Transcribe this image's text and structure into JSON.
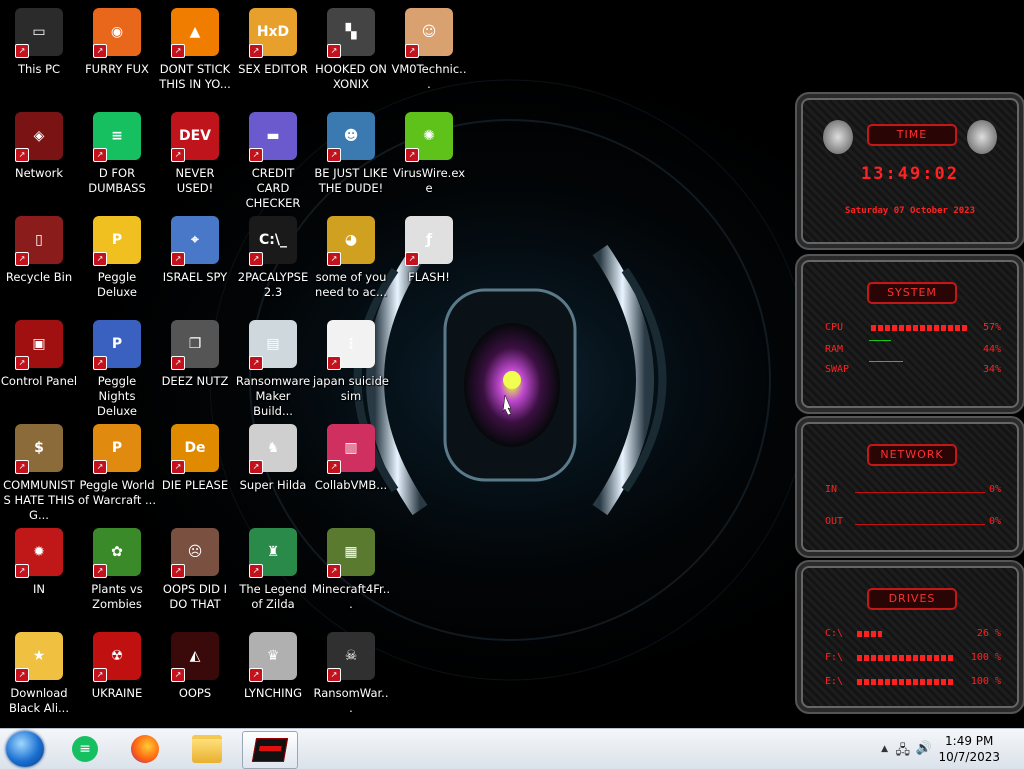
{
  "desktop_icons": [
    {
      "label": "This PC",
      "color": "#2b2b2b",
      "glyph": "▭"
    },
    {
      "label": "FURRY FUX",
      "color": "#e8671a",
      "glyph": "◉"
    },
    {
      "label": "DONT STICK THIS IN YO...",
      "color": "#f07c00",
      "glyph": "▲"
    },
    {
      "label": "SEX EDITOR",
      "color": "#e6a02b",
      "glyph": "HxD"
    },
    {
      "label": "HOOKED ON XONIX",
      "color": "#444444",
      "glyph": "▚"
    },
    {
      "label": "VM0Technic...",
      "color": "#d9a070",
      "glyph": "☺"
    },
    {
      "label": "Network",
      "color": "#7a1414",
      "glyph": "◈"
    },
    {
      "label": "D FOR DUMBASS",
      "color": "#16c060",
      "glyph": "≡"
    },
    {
      "label": "NEVER USED!",
      "color": "#c0141c",
      "glyph": "DEV"
    },
    {
      "label": "CREDIT CARD CHECKER",
      "color": "#6a5acd",
      "glyph": "▬"
    },
    {
      "label": "BE JUST LIKE THE DUDE!",
      "color": "#3a7ab0",
      "glyph": "☻"
    },
    {
      "label": "VirusWire.exe",
      "color": "#5fc21a",
      "glyph": "✺"
    },
    {
      "label": "Recycle Bin",
      "color": "#8a1c1c",
      "glyph": "▯"
    },
    {
      "label": "Peggle Deluxe",
      "color": "#f0c020",
      "glyph": "P"
    },
    {
      "label": "ISRAEL SPY",
      "color": "#4a78c8",
      "glyph": "⌖"
    },
    {
      "label": "2PACALYPSE 2.3",
      "color": "#1a1a1a",
      "glyph": "C:\\_"
    },
    {
      "label": "some of you need to ac...",
      "color": "#d0a020",
      "glyph": "◕"
    },
    {
      "label": "FLASH!",
      "color": "#e0e0e0",
      "glyph": "ƒ"
    },
    {
      "label": "Control Panel",
      "color": "#a01010",
      "glyph": "▣"
    },
    {
      "label": "Peggle Nights Deluxe",
      "color": "#3a60c0",
      "glyph": "P"
    },
    {
      "label": "DEEZ NUTZ",
      "color": "#555555",
      "glyph": "❐"
    },
    {
      "label": "Ransomware Maker Build...",
      "color": "#cfd8dc",
      "glyph": "▤"
    },
    {
      "label": "japan suicide sim",
      "color": "#f2f2f2",
      "glyph": "⋮"
    },
    {
      "label": "COMMUNISTS HATE THIS G...",
      "color": "#8b6b3a",
      "glyph": "$"
    },
    {
      "label": "Peggle World of Warcraft ...",
      "color": "#e08a10",
      "glyph": "P"
    },
    {
      "label": "DIE PLEASE",
      "color": "#e08a00",
      "glyph": "De"
    },
    {
      "label": "Super Hilda",
      "color": "#cfcfcf",
      "glyph": "♞"
    },
    {
      "label": "CollabVMB...",
      "color": "#d03060",
      "glyph": "▥"
    },
    {
      "label": "IN",
      "color": "#c01818",
      "glyph": "✹"
    },
    {
      "label": "Plants vs Zombies",
      "color": "#3a8a2a",
      "glyph": "✿"
    },
    {
      "label": "OOPS DID I DO THAT",
      "color": "#7a5040",
      "glyph": "☹"
    },
    {
      "label": "The Legend of Zilda",
      "color": "#2a8a4a",
      "glyph": "♜"
    },
    {
      "label": "Minecraft4Fr...",
      "color": "#5a7a30",
      "glyph": "▦"
    },
    {
      "label": "Download Black Ali...",
      "color": "#f0c040",
      "glyph": "★"
    },
    {
      "label": "UKRAINE",
      "color": "#c01010",
      "glyph": "☢"
    },
    {
      "label": "OOPS",
      "color": "#3a0a0a",
      "glyph": "◭"
    },
    {
      "label": "LYNCHING",
      "color": "#b0b0b0",
      "glyph": "♛"
    },
    {
      "label": "RansomWar...",
      "color": "#303030",
      "glyph": "☠"
    }
  ],
  "gadget": {
    "time_title": "TIME",
    "time_value": "13:49:02",
    "date_value": "Saturday 07 October 2023",
    "system_title": "SYSTEM",
    "cpu_label": "CPU",
    "cpu_value": "57%",
    "cpu_fraction": 0.57,
    "ram_label": "RAM",
    "ram_value": "44%",
    "swap_label": "SWAP",
    "swap_value": "34%",
    "network_title": "NETWORK",
    "in_label": "IN",
    "in_value": "0%",
    "out_label": "OUT",
    "out_value": "0%",
    "drives_title": "DRIVES",
    "drives": [
      {
        "label": "C:\\",
        "value": "26 %",
        "fraction": 0.26
      },
      {
        "label": "F:\\",
        "value": "100 %",
        "fraction": 1.0
      },
      {
        "label": "E:\\",
        "value": "100 %",
        "fraction": 1.0
      }
    ],
    "accent": "#ff2222"
  },
  "taskbar": {
    "time": "1:49 PM",
    "date": "10/7/2023",
    "pinned": [
      "start-orb",
      "notes-app",
      "firefox",
      "file-explorer",
      "rgb-app"
    ]
  }
}
